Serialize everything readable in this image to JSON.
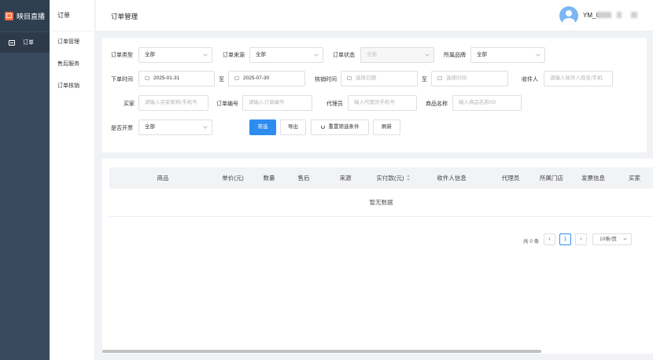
{
  "brand": {
    "name": "映目直播"
  },
  "sidebar": {
    "items": [
      {
        "label": "订单",
        "icon": "order-icon"
      }
    ]
  },
  "subnav": {
    "header": "订单",
    "items": [
      {
        "label": "订单管理"
      },
      {
        "label": "售后服务"
      },
      {
        "label": "订单核销"
      }
    ]
  },
  "topbar": {
    "page_title": "订单管理",
    "user_name": "YM_6"
  },
  "filters": {
    "order_type": {
      "label": "订单类型",
      "value": "全部"
    },
    "order_source": {
      "label": "订单来源",
      "value": "全部"
    },
    "order_status": {
      "label": "订单状态",
      "value": "全部"
    },
    "brand": {
      "label": "所属品牌",
      "value": "全部"
    },
    "order_time": {
      "label": "下单时间",
      "start": "2025-01-31",
      "to": "至",
      "end": "2025-07-30"
    },
    "verify_time": {
      "label": "核销时间",
      "start_placeholder": "选择日期",
      "to": "至",
      "end_placeholder": "选择时间"
    },
    "receiver": {
      "label": "收件人",
      "placeholder": "请输入收件人姓名/手机"
    },
    "buyer": {
      "label": "买家",
      "placeholder": "请输入买家昵称/手机号"
    },
    "order_no": {
      "label": "订单编号",
      "placeholder": "请输入订单编号"
    },
    "agent": {
      "label": "代理员",
      "placeholder": "输入代理员手机号"
    },
    "product_name": {
      "label": "商品名称",
      "placeholder": "输入商品名称/ID"
    },
    "invoice": {
      "label": "是否开票",
      "value": "全部"
    }
  },
  "actions": {
    "filter": "筛选",
    "export": "导出",
    "reset": "重置筛选条件",
    "refresh": "刷新"
  },
  "table": {
    "columns": [
      "商品",
      "单价(元)",
      "数量",
      "售后",
      "来源",
      "实付款(元)",
      "收件人信息",
      "代理员",
      "所属门店",
      "发票信息",
      "买家"
    ],
    "empty_text": "暂无数据"
  },
  "pagination": {
    "total_text": "共 0 条",
    "current_page": "1",
    "page_size": "10条/页"
  },
  "colors": {
    "primary": "#2d8cf0",
    "sidebar": "#3a4a5e",
    "brand_logo": "#ff6a3d"
  }
}
